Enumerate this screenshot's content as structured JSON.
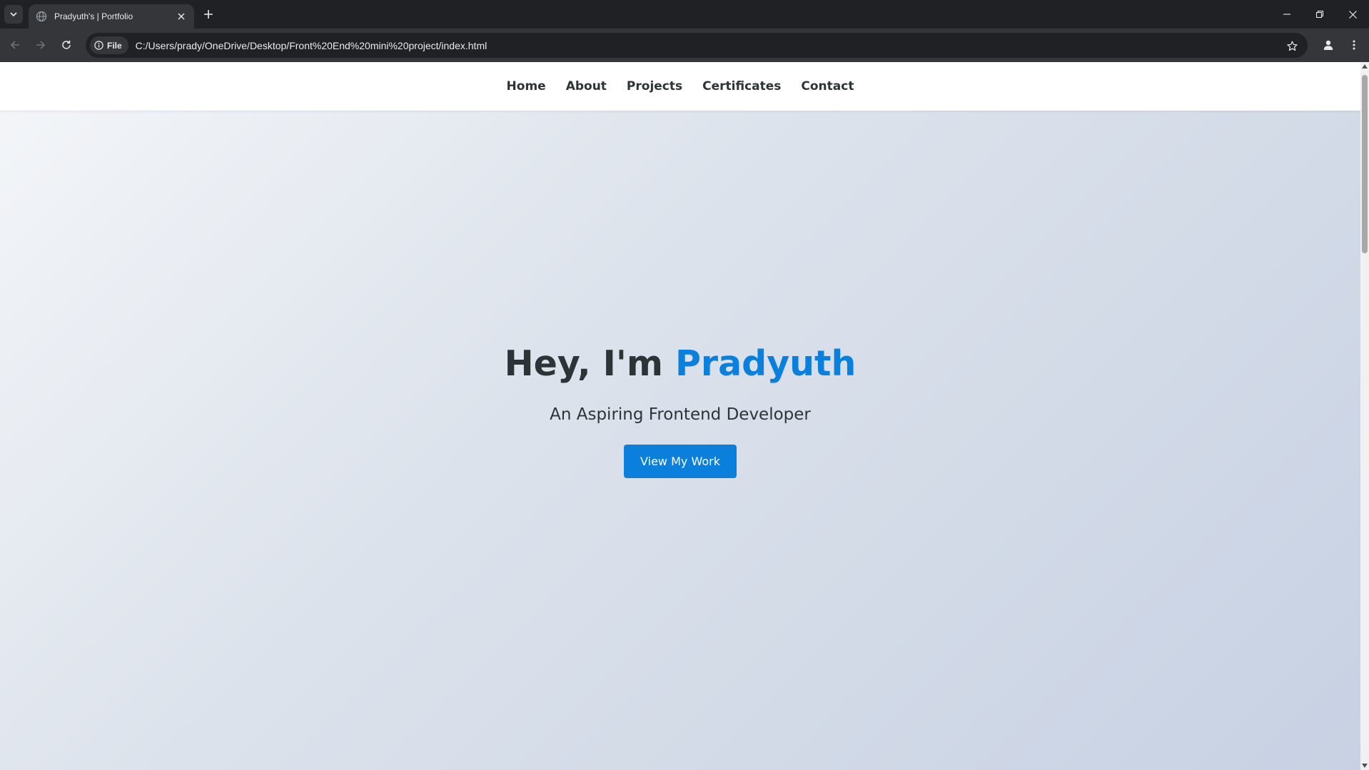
{
  "browser": {
    "tab": {
      "title": "Pradyuth's | Portfolio",
      "favicon": "globe-icon"
    },
    "address_bar": {
      "chip_label": "File",
      "chip_icon": "info-icon",
      "url": "C:/Users/prady/OneDrive/Desktop/Front%20End%20mini%20project/index.html"
    },
    "icons": {
      "tab_search": "chevron-down-icon",
      "new_tab": "plus-icon",
      "back": "arrow-left-icon",
      "forward": "arrow-right-icon",
      "reload": "reload-icon",
      "bookmark": "star-icon",
      "profile": "person-icon",
      "menu": "kebab-menu-icon",
      "minimize": "minimize-icon",
      "restore": "restore-icon",
      "close": "close-icon"
    }
  },
  "page": {
    "nav": {
      "items": [
        {
          "label": "Home"
        },
        {
          "label": "About"
        },
        {
          "label": "Projects"
        },
        {
          "label": "Certificates"
        },
        {
          "label": "Contact"
        }
      ]
    },
    "hero": {
      "greeting": "Hey, I'm ",
      "name": "Pradyuth",
      "subtitle": "An Aspiring Frontend Developer",
      "button_label": "View My Work"
    },
    "colors": {
      "accent": "#0a7fdb",
      "text": "#2d3436",
      "nav_background": "#ffffff",
      "gradient_start": "#f4f6f9",
      "gradient_end": "#c7d1e3"
    }
  }
}
